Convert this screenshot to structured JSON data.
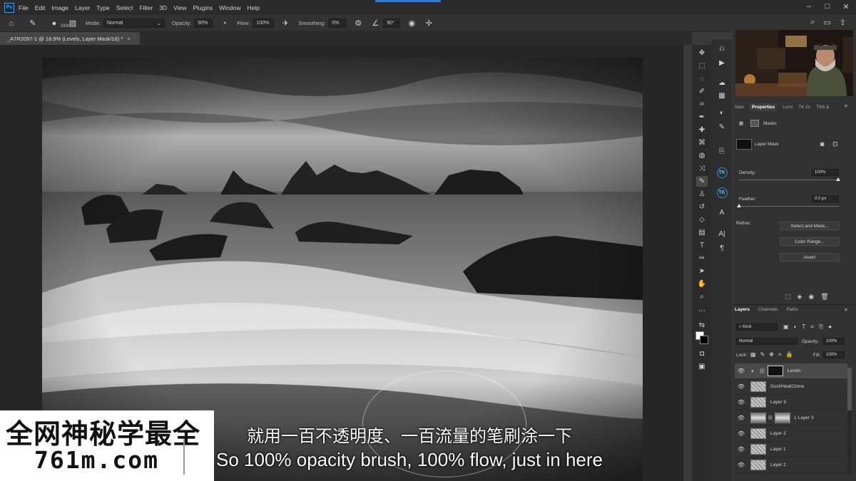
{
  "menubar": {
    "app_icon": "Ps",
    "items": [
      "File",
      "Edit",
      "Image",
      "Layer",
      "Type",
      "Select",
      "Filter",
      "3D",
      "View",
      "Plugins",
      "Window",
      "Help"
    ]
  },
  "options_bar": {
    "brush_size": "3300",
    "mode_label": "Mode:",
    "mode_value": "Normal",
    "opacity_label": "Opacity:",
    "opacity_value": "90%",
    "flow_label": "Flow:",
    "flow_value": "100%",
    "smoothing_label": "Smoothing:",
    "smoothing_value": "0%",
    "angle_value": "90°"
  },
  "document": {
    "tab_title": "_A7R2097-1 @ 18.9% (Levels, Layer Mask/16) *",
    "close_glyph": "×"
  },
  "panel_tabs": [
    "Navi",
    "Properties",
    "Lumi",
    "TK Cr",
    "TK8 &"
  ],
  "properties": {
    "masks_label": "Masks",
    "layer_mask_label": "Layer Mask",
    "density_label": "Density:",
    "density_value": "100%",
    "feather_label": "Feather:",
    "feather_value": "0.0 px",
    "refine_label": "Refine:",
    "select_and_mask": "Select and Mask...",
    "color_range": "Color Range...",
    "invert": "Invert"
  },
  "layers_panel": {
    "tabs": [
      "Layers",
      "Channels",
      "Paths"
    ],
    "filter_kind": "Kind",
    "blend_mode": "Normal",
    "opacity_label": "Opacity:",
    "opacity_value": "100%",
    "lock_label": "Lock:",
    "fill_label": "Fill:",
    "fill_value": "100%",
    "layers": [
      {
        "name": "Levels",
        "selected": true
      },
      {
        "name": "Dust/Heal/Clone",
        "selected": false
      },
      {
        "name": "Layer 3",
        "selected": false
      },
      {
        "name": "L Layer 3",
        "selected": false
      },
      {
        "name": "Layer 2",
        "selected": false
      },
      {
        "name": "Layer 1",
        "selected": false
      },
      {
        "name": "Layer 2",
        "selected": false
      }
    ]
  },
  "subtitles": {
    "chinese": "就用一百不透明度、一百流量的笔刷涂一下",
    "english": "So 100% opacity brush, 100% flow, just in here"
  },
  "watermark": {
    "line1": "全网神秘学最全",
    "line2": "761m.com"
  },
  "colors": {
    "menubar_bg": "#2b2b2b",
    "panel_bg": "#323232",
    "canvas_bg": "#262626",
    "accent_blue": "#31a8ff"
  }
}
